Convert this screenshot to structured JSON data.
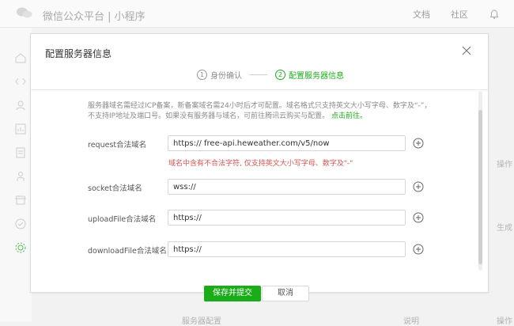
{
  "app": {
    "brand": "微信公众平台 | 小程序",
    "top_links": [
      "文档",
      "社区"
    ]
  },
  "background": {
    "col_operation": "操作",
    "col_generate": "生成",
    "footer_left": "服务器配置",
    "footer_mid": "说明",
    "footer_right": "操作"
  },
  "modal": {
    "title": "配置服务器信息",
    "steps": [
      {
        "num": "1",
        "label": "身份确认",
        "active": false
      },
      {
        "num": "2",
        "label": "配置服务器信息",
        "active": true
      }
    ],
    "description": "服务器域名需经过ICP备案，新备案域名需24小时后才可配置。域名格式只支持英文大小写字母、数字及“-”，不支持IP地址及端口号。如果没有服务器与域名，可前往腾讯云购买与配置。",
    "description_link": "点击前往。",
    "rows": [
      {
        "label": "request合法域名",
        "value": "https:// free-api.heweather.com/v5/now"
      },
      {
        "label": "socket合法域名",
        "value": "wss://"
      },
      {
        "label": "uploadFile合法域名",
        "value": "https://"
      },
      {
        "label": "downloadFile合法域名",
        "value": "https://"
      }
    ],
    "error": "域名中含有不合法字符, 仅支持英文大小写字母、数字及\"-\"",
    "buttons": {
      "primary": "保存并提交",
      "secondary": "取消"
    }
  },
  "colors": {
    "accent": "#1aad19",
    "error": "#d9534f"
  }
}
